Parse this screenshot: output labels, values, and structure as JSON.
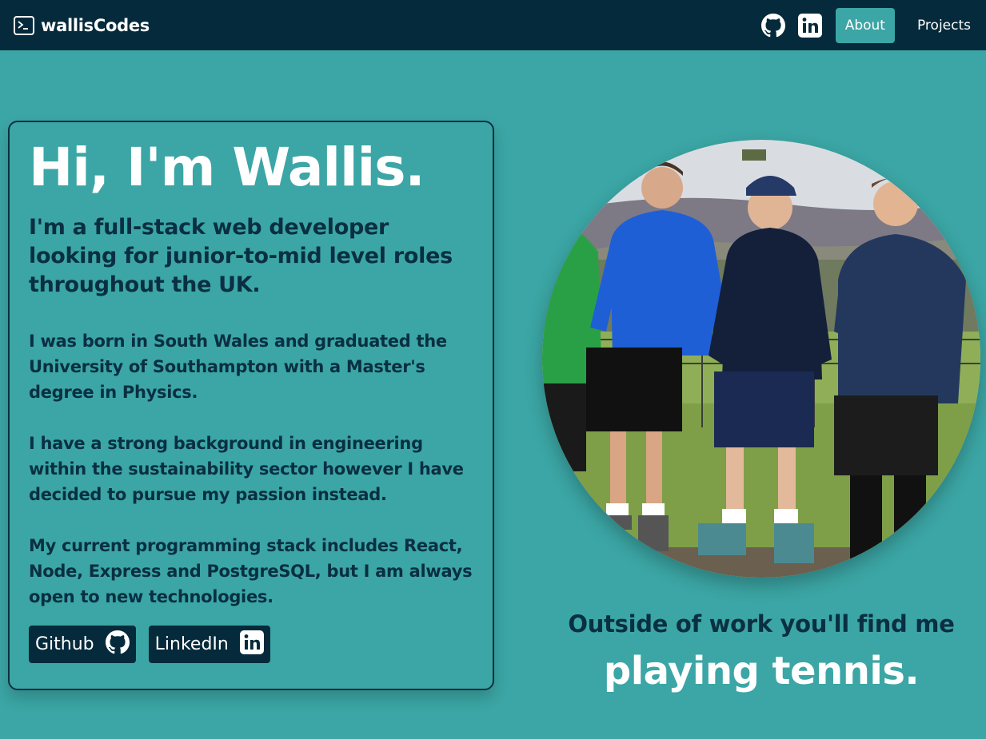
{
  "nav": {
    "brand": "wallisCodes",
    "about_label": "About",
    "projects_label": "Projects",
    "colors": {
      "nav_bg": "#052a3b",
      "accent": "#3ba6a5"
    }
  },
  "intro": {
    "title": "Hi, I'm Wallis.",
    "subtitle": "I'm a full-stack web developer looking for junior-to-mid level roles throughout the UK.",
    "paragraphs": [
      "I was born in South Wales and graduated the University of Southampton with a Master's degree in Physics.",
      "I have a strong background in engineering within the sustainability sector however I have decided to pursue my passion instead.",
      "My current programming stack includes React, Node, Express and PostgreSQL, but I am always open to new technologies."
    ],
    "github_label": "Github",
    "linkedin_label": "LinkedIn"
  },
  "hobby": {
    "line1": "Outside of work you'll find me",
    "line2": "playing tennis."
  },
  "icons": [
    "terminal-icon",
    "github-icon",
    "linkedin-icon"
  ]
}
